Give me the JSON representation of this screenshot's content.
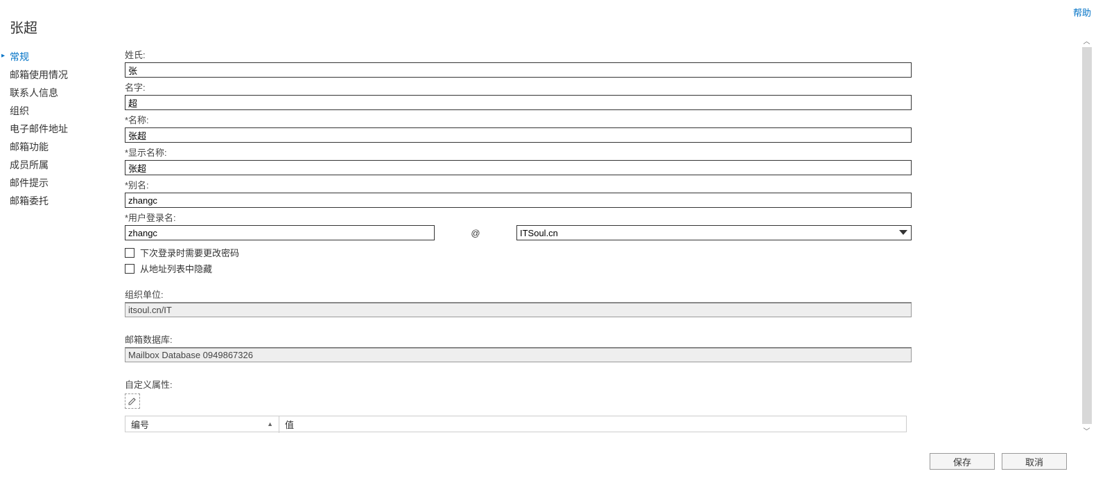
{
  "header": {
    "title": "张超",
    "help_link": "帮助"
  },
  "sidebar": {
    "items": [
      {
        "label": "常规",
        "active": true
      },
      {
        "label": "邮箱使用情况",
        "active": false
      },
      {
        "label": "联系人信息",
        "active": false
      },
      {
        "label": "组织",
        "active": false
      },
      {
        "label": "电子邮件地址",
        "active": false
      },
      {
        "label": "邮箱功能",
        "active": false
      },
      {
        "label": "成员所属",
        "active": false
      },
      {
        "label": "邮件提示",
        "active": false
      },
      {
        "label": "邮箱委托",
        "active": false
      }
    ]
  },
  "form": {
    "lastname_label": "姓氏:",
    "lastname_value": "张",
    "firstname_label": "名字:",
    "firstname_value": "超",
    "name_label": "*名称:",
    "name_value": "张超",
    "displayname_label": "*显示名称:",
    "displayname_value": "张超",
    "alias_label": "*别名:",
    "alias_value": "zhangc",
    "userlogin_label": "*用户登录名:",
    "userlogin_value": "zhangc",
    "at_symbol": "@",
    "domain_value": "ITSoul.cn",
    "checkbox1_label": "下次登录时需要更改密码",
    "checkbox2_label": "从地址列表中隐藏",
    "orgunit_label": "组织单位:",
    "orgunit_value": "itsoul.cn/IT",
    "mailboxdb_label": "邮箱数据库:",
    "mailboxdb_value": "Mailbox Database 0949867326",
    "customattr_label": "自定义属性:",
    "table_col1": "编号",
    "table_col2": "值"
  },
  "footer": {
    "save_label": "保存",
    "cancel_label": "取消"
  }
}
